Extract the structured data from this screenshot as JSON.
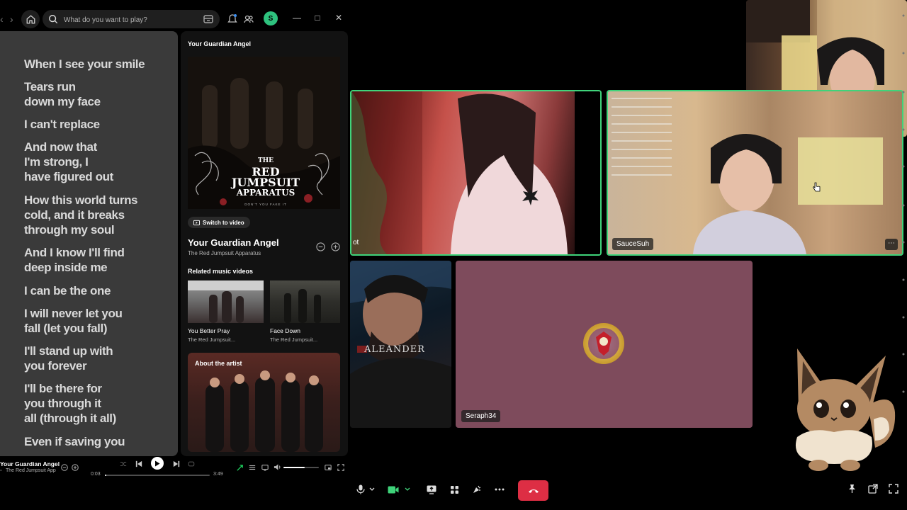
{
  "spotify": {
    "search_placeholder": "What do you want to play?",
    "avatar_letter": "S",
    "lyrics": [
      "When I see your smile",
      "Tears run\ndown my face",
      "I can't replace",
      "And now that\nI'm strong, I\nhave figured out",
      "How this world turns\ncold, and it breaks\nthrough my soul",
      "And I know I'll find\ndeep inside me",
      "I can be the one",
      "I will never let you\nfall (let you fall)",
      "I'll stand up with\nyou forever",
      "I'll be there for\nyou through it\nall (through it all)",
      "Even if saving you"
    ],
    "now_playing": {
      "header": "Your Guardian Angel",
      "switch_to_video": "Switch to video",
      "title": "Your Guardian Angel",
      "artist": "The Red Jumpsuit Apparatus",
      "cover_text_line1": "THE",
      "cover_text_line2": "RED",
      "cover_text_line3": "JUMPSUIT",
      "cover_text_line4": "APPARATUS",
      "cover_small_text": "DON'T YOU FAKE IT"
    },
    "related": {
      "heading": "Related music videos",
      "items": [
        {
          "title": "You Better Pray",
          "artist": "The Red Jumpsuit..."
        },
        {
          "title": "Face Down",
          "artist": "The Red Jumpsuit..."
        }
      ]
    },
    "about_artist": "About the artist",
    "player": {
      "title": "Your Guardian Angel",
      "artist": "The Red Jumpsuit App",
      "elapsed": "0:03",
      "total": "3:49",
      "progress": 0.013,
      "volume": 0.6
    }
  },
  "call": {
    "participants": [
      {
        "name": "ot"
      },
      {
        "name": "SauceSuh"
      },
      {
        "name": ""
      },
      {
        "name": "Seraph34"
      }
    ],
    "colors": {
      "speaking_border": "#3fd37a",
      "end_call": "#dd2e44",
      "seraph_bg": "#7e4b5c"
    }
  }
}
